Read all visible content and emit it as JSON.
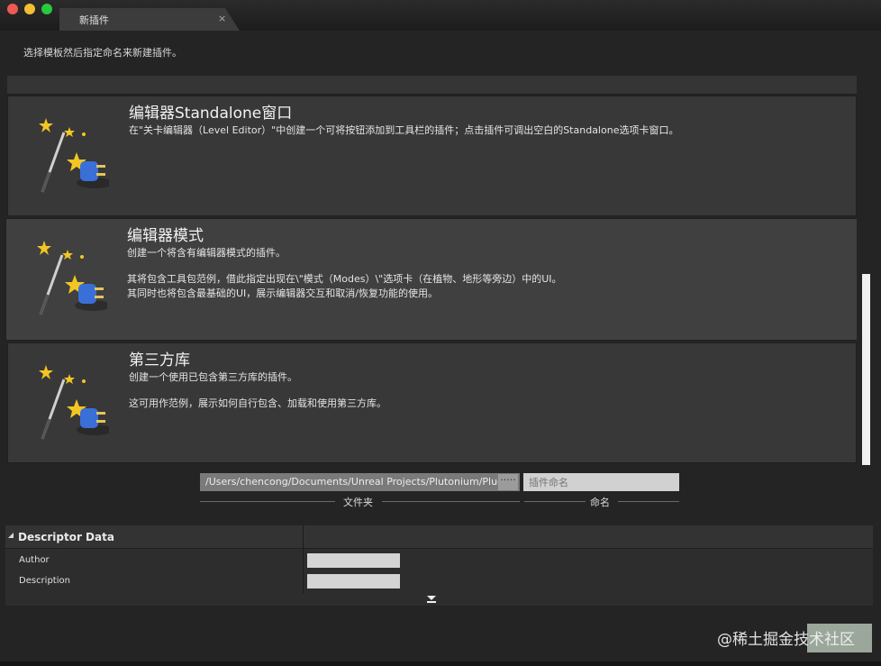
{
  "window": {
    "tab_label": "新插件",
    "tab_close": "×",
    "instruction": "选择模板然后指定命名来新建插件。"
  },
  "templates": [
    {
      "title": "编辑器Standalone窗口",
      "desc": [
        "在\"关卡编辑器（Level Editor）\"中创建一个可将按钮添加到工具栏的插件；点击插件可调出空白的Standalone选项卡窗口。"
      ],
      "icon": "plugin-wand-icon"
    },
    {
      "title": "编辑器模式",
      "desc": [
        "创建一个将含有编辑器模式的插件。",
        "其将包含工具包范例，借此指定出现在\\\"模式（Modes）\\\"选项卡（在植物、地形等旁边）中的UI。\n其同时也将包含最基础的UI，展示编辑器交互和取消/恢复功能的使用。"
      ],
      "icon": "plugin-wand-icon",
      "selected": true
    },
    {
      "title": "第三方库",
      "desc": [
        "创建一个使用已包含第三方库的插件。",
        "这可用作范例，展示如何自行包含、加载和使用第三方库。"
      ],
      "icon": "plugin-wand-icon"
    }
  ],
  "path_field": {
    "value": "/Users/chencong/Documents/Unreal Projects/Plutonium/Plug",
    "browse_label": "·····",
    "label": "文件夹"
  },
  "name_field": {
    "value": "",
    "placeholder": "插件命名",
    "label": "命名"
  },
  "descriptor": {
    "header": "Descriptor Data",
    "rows": [
      {
        "label": "Author",
        "value": ""
      },
      {
        "label": "Description",
        "value": ""
      }
    ],
    "expand_icon": "expand-down-icon"
  },
  "watermark": "@稀土掘金技术社区",
  "colors": {
    "window_bg": "#242424",
    "card_bg": "#383838",
    "card_selected_bg": "#404040",
    "accent_star": "#f3c623",
    "plug_blue": "#3a6fd8"
  }
}
